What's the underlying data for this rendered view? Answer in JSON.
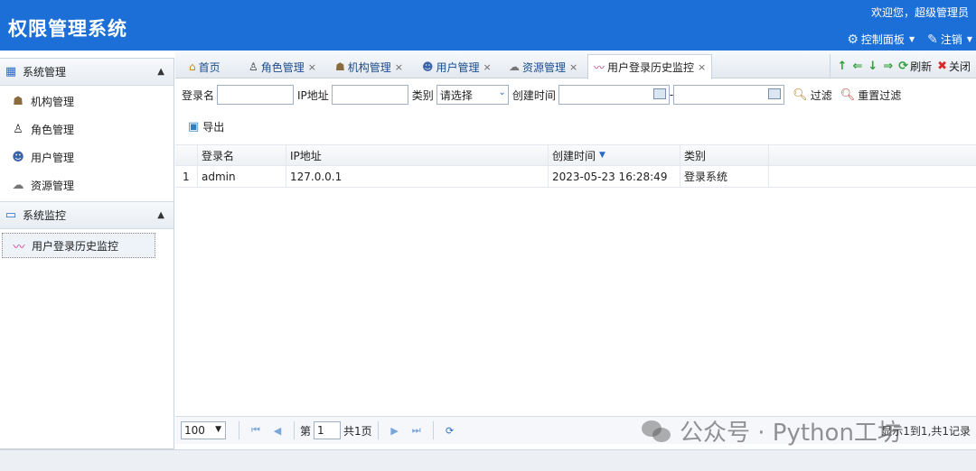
{
  "header": {
    "title": "权限管理系统",
    "welcome": "欢迎您，超级管理员",
    "menu": [
      {
        "label": "控制面板",
        "icon": "gear-icon"
      },
      {
        "label": "注销",
        "icon": "logout-icon"
      }
    ]
  },
  "sidebar": {
    "groups": [
      {
        "title": "系统管理",
        "items": [
          "机构管理",
          "角色管理",
          "用户管理",
          "资源管理"
        ]
      },
      {
        "title": "系统监控",
        "items": [
          "用户登录历史监控"
        ]
      }
    ]
  },
  "tabs": [
    {
      "label": "首页"
    },
    {
      "label": "角色管理"
    },
    {
      "label": "机构管理"
    },
    {
      "label": "用户管理"
    },
    {
      "label": "资源管理"
    },
    {
      "label": "用户登录历史监控"
    }
  ],
  "tools": {
    "refresh": "刷新",
    "close": "关闭"
  },
  "filter": {
    "login_name_label": "登录名",
    "ip_label": "IP地址",
    "category_label": "类别",
    "category_value": "请选择",
    "created_label": "创建时间",
    "range_sep": "-",
    "filter_btn": "过滤",
    "reset_btn": "重置过滤"
  },
  "export_label": "导出",
  "grid": {
    "columns": [
      "登录名",
      "IP地址",
      "创建时间",
      "类别"
    ],
    "rows": [
      {
        "idx": "1",
        "name": "admin",
        "ip": "127.0.0.1",
        "time": "2023-05-23 16:28:49",
        "category": "登录系统"
      }
    ]
  },
  "pager": {
    "page_size": "100",
    "page_prefix": "第",
    "page_num": "1",
    "page_total": "共1页",
    "info": "显示1到1,共1记录"
  },
  "watermark": {
    "text": "公众号 · Python工坊"
  },
  "colors": {
    "header": "#1d6fd8",
    "accent": "#2b6cc4"
  }
}
